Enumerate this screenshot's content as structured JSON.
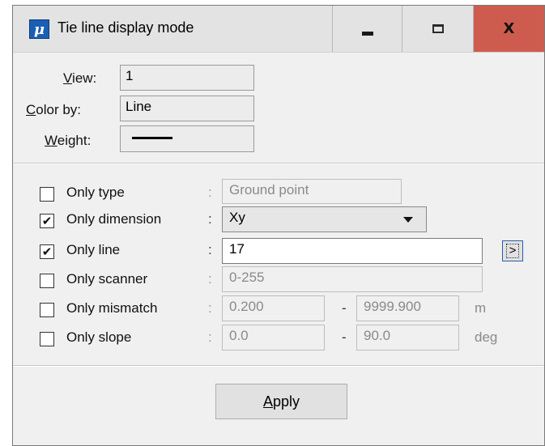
{
  "window": {
    "title": "Tie line display mode",
    "icon": "microstation-icon",
    "controls": {
      "minimize": "minimize-icon",
      "maximize": "maximize-icon",
      "close": "X"
    },
    "accent_close": "#cd5c4f"
  },
  "top": {
    "view": {
      "label_u": "V",
      "label_rest": "iew:",
      "value": "1"
    },
    "color_by": {
      "label_u": "C",
      "label_rest": "olor by:",
      "value": "Line"
    },
    "weight": {
      "label_u": "W",
      "label_rest": "eight:"
    }
  },
  "filters": [
    {
      "label": "Only type",
      "checked": false,
      "value": "Ground point"
    },
    {
      "label": "Only dimension",
      "checked": true,
      "value": "Xy"
    },
    {
      "label": "Only line",
      "checked": true,
      "value": "17",
      "button": ">"
    },
    {
      "label": "Only scanner",
      "checked": false,
      "value": "0-255"
    },
    {
      "label": "Only mismatch",
      "checked": false,
      "from": "0.200",
      "to": "9999.900",
      "unit": "m"
    },
    {
      "label": "Only slope",
      "checked": false,
      "from": "0.0",
      "to": "90.0",
      "unit": "deg"
    }
  ],
  "colon": ":",
  "dash": "-",
  "check_mark": "✔",
  "apply": {
    "label_u": "A",
    "label_rest": "pply"
  }
}
